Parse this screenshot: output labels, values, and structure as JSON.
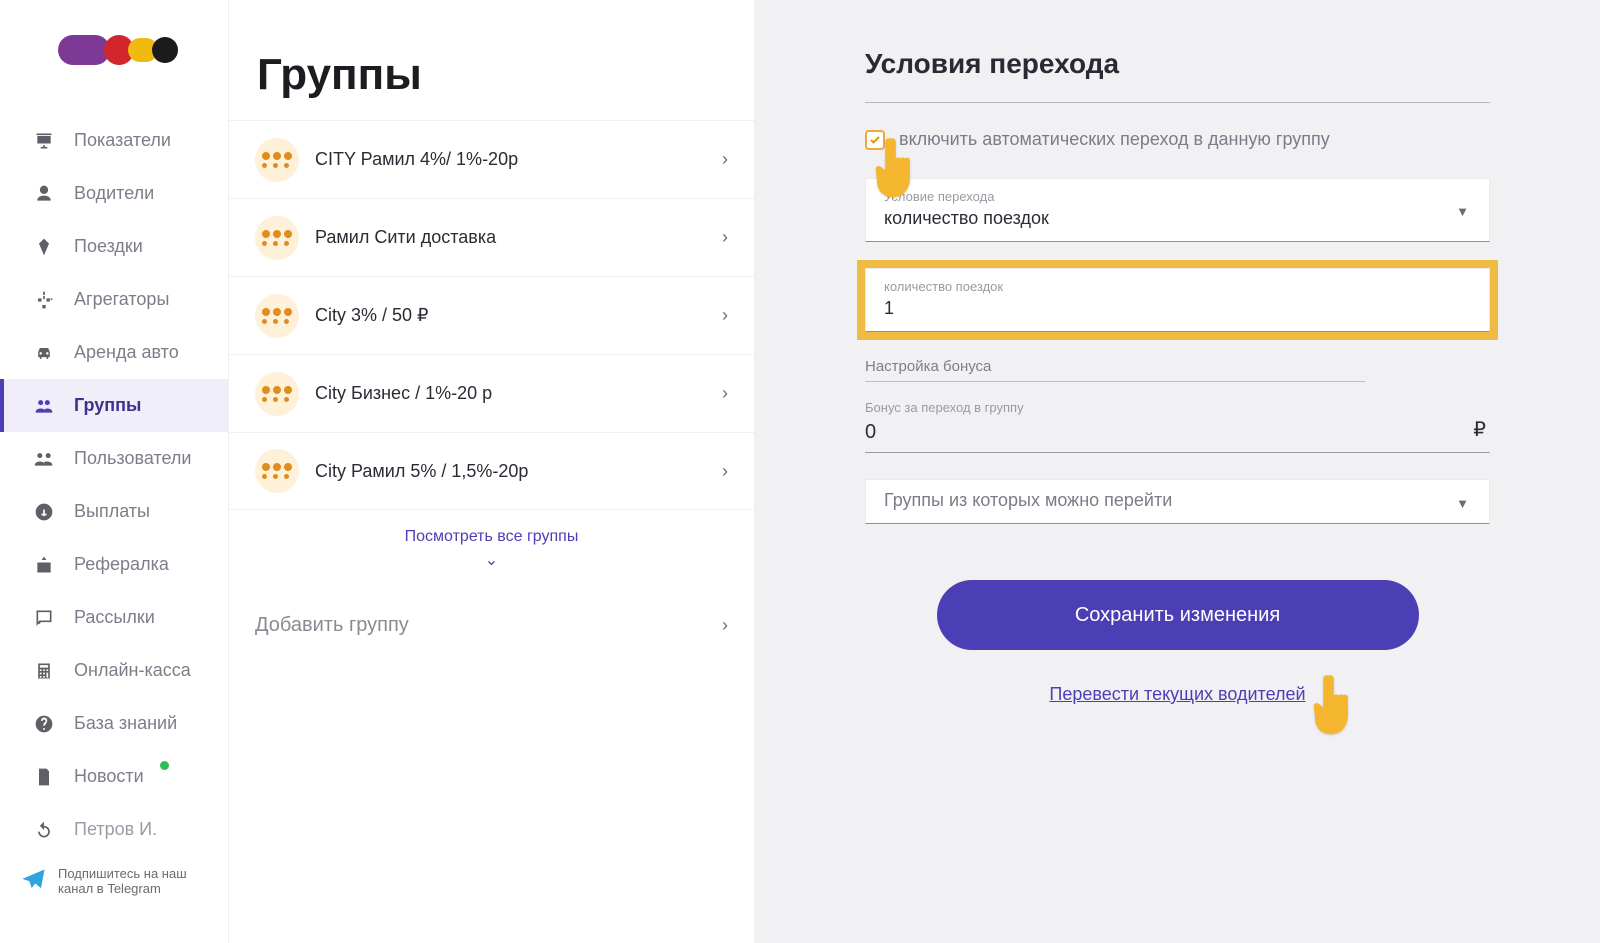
{
  "sidebar": {
    "items": [
      {
        "label": "Показатели",
        "icon": "presentation-icon"
      },
      {
        "label": "Водители",
        "icon": "user-icon"
      },
      {
        "label": "Поездки",
        "icon": "diamond-icon"
      },
      {
        "label": "Агрегаторы",
        "icon": "hierarchy-icon"
      },
      {
        "label": "Аренда авто",
        "icon": "car-icon"
      },
      {
        "label": "Группы",
        "icon": "users-icon",
        "active": true
      },
      {
        "label": "Пользователи",
        "icon": "users-pair-icon"
      },
      {
        "label": "Выплаты",
        "icon": "payout-icon"
      },
      {
        "label": "Рефералка",
        "icon": "referral-icon"
      },
      {
        "label": "Рассылки",
        "icon": "chat-icon"
      },
      {
        "label": "Онлайн-касса",
        "icon": "calculator-icon"
      },
      {
        "label": "База знаний",
        "icon": "help-icon"
      },
      {
        "label": "Новости",
        "icon": "doc-icon",
        "badge": true
      }
    ],
    "user": {
      "label": "Петров И.",
      "icon": "refresh-icon"
    },
    "telegram_promo": "Подпишитесь на наш канал в Telegram"
  },
  "middle": {
    "title": "Группы",
    "groups": [
      {
        "label": "CITY Рамил 4%/ 1%-20р"
      },
      {
        "label": "Рамил Сити доставка"
      },
      {
        "label": "City 3% / 50 ₽"
      },
      {
        "label": "City Бизнес / 1%-20 р"
      },
      {
        "label": "City Рамил 5% / 1,5%-20р"
      }
    ],
    "see_all": "Посмотреть все группы",
    "add": "Добавить группу"
  },
  "right": {
    "title": "Условия перехода",
    "auto_switch_label": "включить автоматических переход в данную группу",
    "condition": {
      "label": "Условие перехода",
      "value": "количество поездок"
    },
    "trips": {
      "label": "количество поездок",
      "value": "1"
    },
    "bonus_section": "Настройка бонуса",
    "bonus": {
      "label": "Бонус за переход в группу",
      "value": "0",
      "unit": "₽"
    },
    "from_groups": {
      "placeholder": "Группы из которых можно перейти"
    },
    "save": "Сохранить изменения",
    "transfer": "Перевести текущих водителей"
  }
}
